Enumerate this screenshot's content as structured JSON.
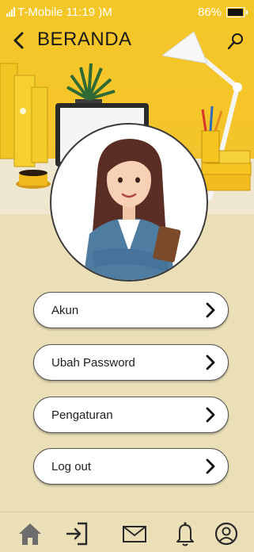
{
  "status_bar": {
    "carrier_time": "T-Mobile 11:19 )M",
    "battery": "86%"
  },
  "header": {
    "title": "BERANDA"
  },
  "menu": {
    "items": [
      {
        "label": "Akun"
      },
      {
        "label": "Ubah Password"
      },
      {
        "label": "Pengaturan"
      },
      {
        "label": "Log out"
      }
    ]
  },
  "bottom_nav": {
    "items": [
      {
        "icon": "home-icon"
      },
      {
        "icon": "login-icon"
      },
      {
        "icon": "mail-icon"
      },
      {
        "icon": "bell-icon"
      },
      {
        "icon": "profile-icon"
      }
    ]
  },
  "colors": {
    "background": "#eadfb6",
    "header_yellow": "#f3c728",
    "button_fill": "#ffffff",
    "text": "#1a1a1a"
  }
}
